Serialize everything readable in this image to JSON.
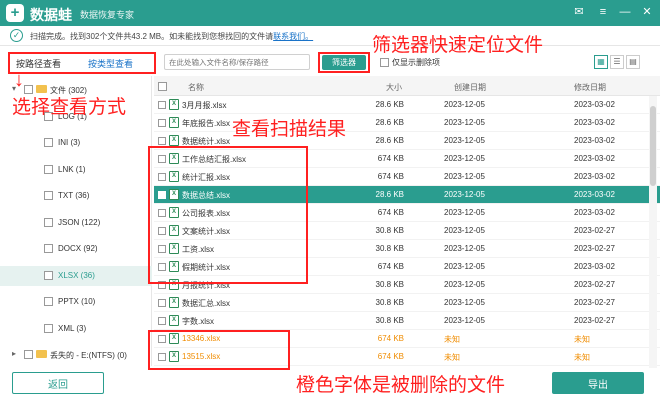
{
  "app": {
    "name": "数据蛙",
    "subtitle": "数据恢复专家",
    "logo_glyph": "+"
  },
  "window_controls": {
    "feedback_glyph": "✉",
    "menu_glyph": "≡",
    "minimize_glyph": "—",
    "close_glyph": "✕"
  },
  "status": {
    "icon_glyph": "✓",
    "message": "扫描完成。找到302个文件共43.2 MB。如未能找到您想找回的文件请",
    "link": "联系我们。"
  },
  "view_tabs": {
    "by_path": "按路径查看",
    "by_type": "按类型查看"
  },
  "toolbar": {
    "search_placeholder": "在此处输入文件名称/保存路径",
    "filter_button": "筛选器",
    "show_deleted_only": "仅显示删除项",
    "view_icons": [
      "▦",
      "☰",
      "▤"
    ]
  },
  "sidebar": {
    "items": [
      {
        "label": "文件 (302)",
        "level": 0,
        "arrow": "▾",
        "folder": true
      },
      {
        "label": "LOG (1)",
        "level": 1
      },
      {
        "label": "INI (3)",
        "level": 1
      },
      {
        "label": "LNK (1)",
        "level": 1
      },
      {
        "label": "TXT (36)",
        "level": 1
      },
      {
        "label": "JSON (122)",
        "level": 1
      },
      {
        "label": "DOCX (92)",
        "level": 1
      },
      {
        "label": "XLSX (36)",
        "level": 1,
        "selected": true
      },
      {
        "label": "PPTX (10)",
        "level": 1
      },
      {
        "label": "XML (3)",
        "level": 1
      },
      {
        "label": "丢失的 - E:(NTFS) (0)",
        "level": 0,
        "arrow": "▸",
        "folder": true
      }
    ]
  },
  "table": {
    "headers": {
      "name": "名称",
      "size": "大小",
      "created": "创建日期",
      "modified": "修改日期"
    },
    "rows": [
      {
        "name": "3月月报.xlsx",
        "size": "28.6 KB",
        "created": "2023-12-05",
        "modified": "2023-03-02"
      },
      {
        "name": "年底报告.xlsx",
        "size": "28.6 KB",
        "created": "2023-12-05",
        "modified": "2023-03-02"
      },
      {
        "name": "数据统计.xlsx",
        "size": "28.6 KB",
        "created": "2023-12-05",
        "modified": "2023-03-02"
      },
      {
        "name": "工作总结汇报.xlsx",
        "size": "674 KB",
        "created": "2023-12-05",
        "modified": "2023-03-02"
      },
      {
        "name": "统计汇报.xlsx",
        "size": "674 KB",
        "created": "2023-12-05",
        "modified": "2023-03-02"
      },
      {
        "name": "数据总结.xlsx",
        "size": "28.6 KB",
        "created": "2023-12-05",
        "modified": "2023-03-02",
        "highlight": true
      },
      {
        "name": "公司报表.xlsx",
        "size": "674 KB",
        "created": "2023-12-05",
        "modified": "2023-03-02"
      },
      {
        "name": "文案统计.xlsx",
        "size": "30.8 KB",
        "created": "2023-12-05",
        "modified": "2023-02-27"
      },
      {
        "name": "工资.xlsx",
        "size": "30.8 KB",
        "created": "2023-12-05",
        "modified": "2023-02-27"
      },
      {
        "name": "假期统计.xlsx",
        "size": "674 KB",
        "created": "2023-12-05",
        "modified": "2023-03-02"
      },
      {
        "name": "月报统计.xlsx",
        "size": "30.8 KB",
        "created": "2023-12-05",
        "modified": "2023-02-27"
      },
      {
        "name": "数据汇总.xlsx",
        "size": "30.8 KB",
        "created": "2023-12-05",
        "modified": "2023-02-27"
      },
      {
        "name": "字数.xlsx",
        "size": "30.8 KB",
        "created": "2023-12-05",
        "modified": "2023-02-27"
      },
      {
        "name": "13346.xlsx",
        "size": "674 KB",
        "created": "未知",
        "modified": "未知",
        "deleted": true
      },
      {
        "name": "13515.xlsx",
        "size": "674 KB",
        "created": "未知",
        "modified": "未知",
        "deleted": true
      }
    ]
  },
  "buttons": {
    "back": "返回",
    "export": "导出"
  },
  "annotations": {
    "filter": "筛选器快速定位文件",
    "view_mode": "选择查看方式",
    "scan_result": "查看扫描结果",
    "deleted": "橙色字体是被删除的文件"
  },
  "colors": {
    "accent": "#2a9d8f",
    "deleted": "#f08c00",
    "annotation": "#ff2020",
    "link": "#1a73c8"
  }
}
